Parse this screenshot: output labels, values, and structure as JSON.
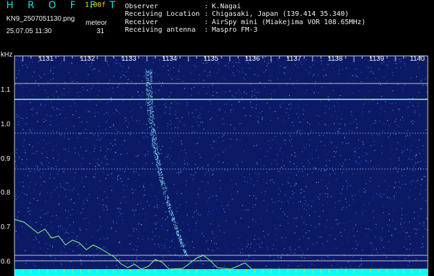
{
  "header": {
    "app_title": "H R O F F T",
    "version": "1.00f",
    "filename": "KN9_2507051130.png",
    "timestamp": "25.07.05 11:30",
    "meteor_label": "meteor",
    "meteor_count": "31"
  },
  "info": [
    {
      "label": "Observer",
      "value": "K.Nagai"
    },
    {
      "label": "Receiving Location",
      "value": "Chigasaki, Japan (139.414 35.340)"
    },
    {
      "label": "Receiver",
      "value": "AirSpy mini (Miakejima VOR 108.65MHz)"
    },
    {
      "label": "Receiving antenna",
      "value": "Maspro FM-3"
    }
  ],
  "axes": {
    "y_unit": "kHz",
    "x_labels": [
      "1131",
      "1132",
      "1133",
      "1134",
      "1135",
      "1136",
      "1137",
      "1138",
      "1139",
      "1140"
    ],
    "y_labels": [
      "1.1",
      "1.0",
      "0.9",
      "0.8",
      "0.7",
      "0.6"
    ]
  },
  "colors": {
    "background": "#000000",
    "spectrogram": "#0c1a66",
    "signal": "#7fffd0",
    "trace": "#8cff8c",
    "baseline": "#00ffff",
    "title": "#00e6e6",
    "version": "#f0e000"
  }
}
